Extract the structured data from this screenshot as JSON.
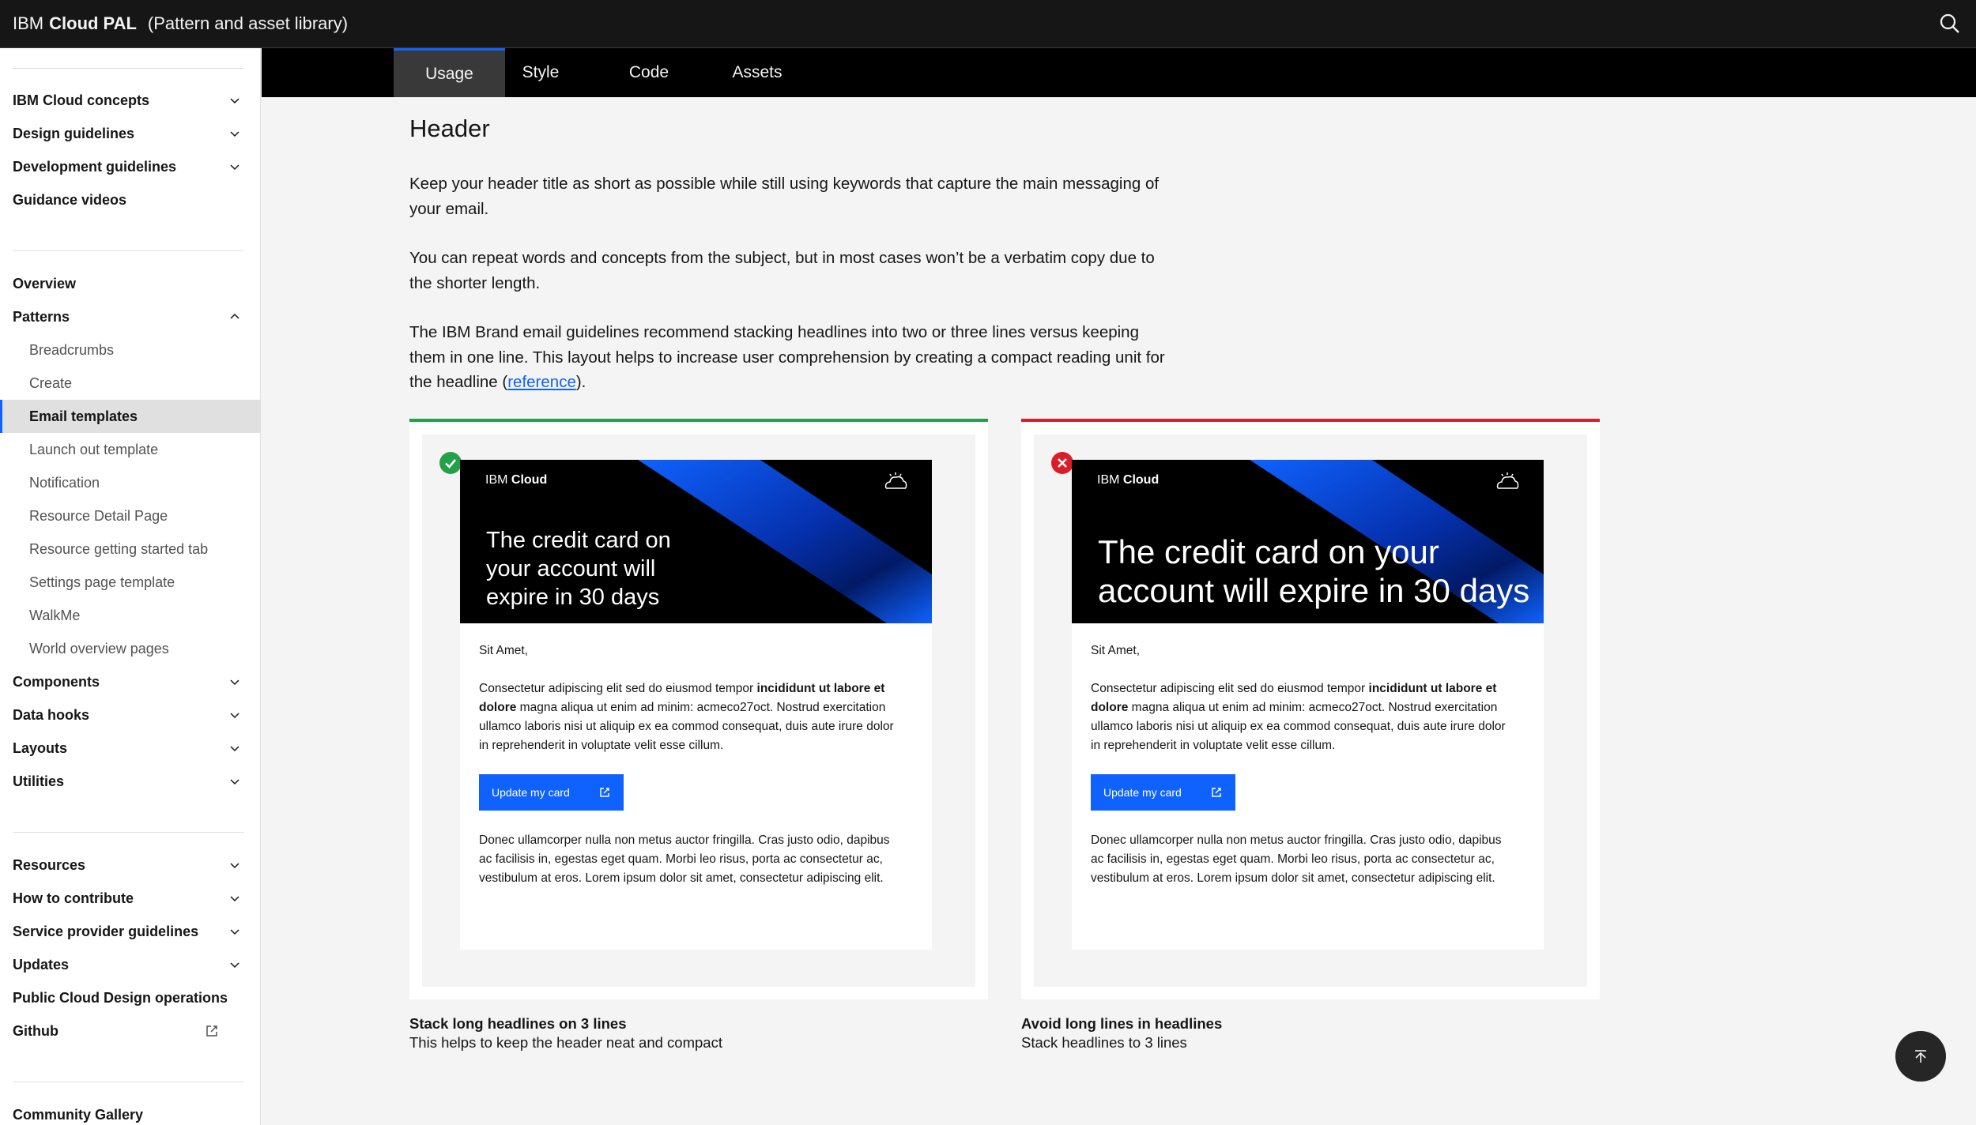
{
  "header": {
    "brand_ibm": "IBM",
    "brand_name": "Cloud PAL",
    "brand_desc": "(Pattern and asset library)",
    "search_icon": "search-icon"
  },
  "sidebar": {
    "group1": [
      {
        "label": "IBM Cloud concepts",
        "expandable": true
      },
      {
        "label": "Design guidelines",
        "expandable": true
      },
      {
        "label": "Development guidelines",
        "expandable": true
      },
      {
        "label": "Guidance videos",
        "expandable": false
      }
    ],
    "overview": "Overview",
    "patterns": "Patterns",
    "patterns_children": [
      "Breadcrumbs",
      "Create",
      "Email templates",
      "Launch out template",
      "Notification",
      "Resource Detail Page",
      "Resource getting started tab",
      "Settings page template",
      "WalkMe",
      "World overview pages"
    ],
    "active_child": "Email templates",
    "group2": [
      {
        "label": "Components",
        "expandable": true
      },
      {
        "label": "Data hooks",
        "expandable": true
      },
      {
        "label": "Layouts",
        "expandable": true
      },
      {
        "label": "Utilities",
        "expandable": true
      }
    ],
    "group3": [
      {
        "label": "Resources",
        "expandable": true
      },
      {
        "label": "How to contribute",
        "expandable": true
      },
      {
        "label": "Service provider guidelines",
        "expandable": true
      },
      {
        "label": "Updates",
        "expandable": true
      },
      {
        "label": "Public Cloud Design operations",
        "expandable": false
      }
    ],
    "github": "Github",
    "community": "Community Gallery"
  },
  "tabs": [
    "Usage",
    "Style",
    "Code",
    "Assets"
  ],
  "active_tab": "Usage",
  "content": {
    "title": "Header",
    "para1": "Keep your header title as short as possible while still using keywords that capture the main messaging of your email.",
    "para2": "You can repeat words and concepts from the subject, but in most cases won’t be a verbatim copy due to the shorter length.",
    "para3_before": "The IBM Brand email guidelines recommend stacking headlines into two or three lines versus keeping them in one line. This layout helps to increase user comprehension by creating a compact reading unit for the headline (",
    "para3_link": "reference",
    "para3_after": ")."
  },
  "email": {
    "ibm": "IBM",
    "cloud": "Cloud",
    "headline": "The credit card on your account will expire in 30 days",
    "greeting": "Sit Amet,",
    "body1_start": "Consectetur adipiscing elit sed do eiusmod tempor ",
    "body1_bold": "incididunt ut labore et dolore",
    "body1_end": " magna aliqua ut enim ad minim: acmeco27oct. Nostrud exercitation ullamco laboris nisi ut aliquip ex ea commod consequat, duis aute irure dolor in reprehenderit in voluptate velit esse cillum.",
    "cta": "Update my card",
    "body2": "Donec ullamcorper nulla non metus auctor fringilla. Cras justo odio, dapibus ac facilisis in, egestas eget quam. Morbi leo risus, porta ac consectetur ac, vestibulum at eros. Lorem ipsum dolor sit amet, consectetur adipiscing elit."
  },
  "captions": {
    "good_title": "Stack long headlines on 3 lines",
    "good_sub": "This helps to keep the header neat and compact",
    "bad_title": "Avoid long lines in headlines",
    "bad_sub": "Stack headlines to 3 lines"
  },
  "colors": {
    "brand_blue": "#0f62fe",
    "success": "#24a148",
    "error": "#da1e28",
    "header_bg": "#161616"
  }
}
